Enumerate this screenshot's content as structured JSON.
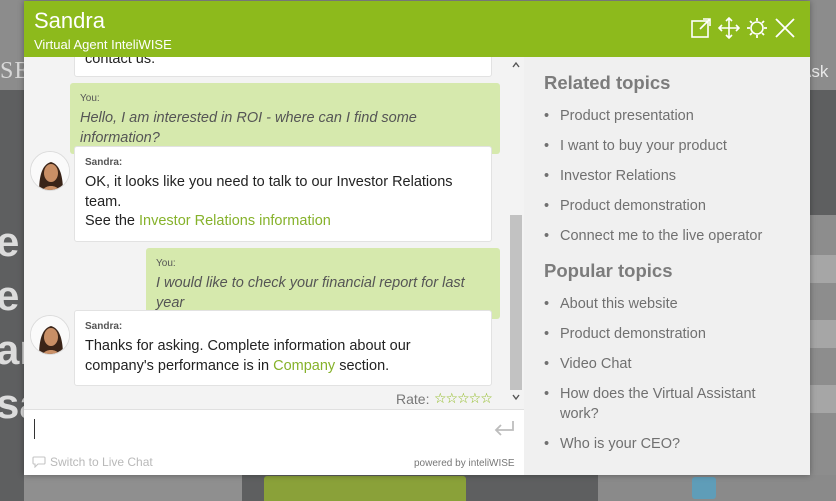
{
  "background": {
    "logo": "SE",
    "ask": "Ask f",
    "hero_lines": [
      "e",
      "e v",
      "an",
      "sa"
    ]
  },
  "header": {
    "agent_name": "Sandra",
    "subtitle": "Virtual Agent InteliWISE",
    "color": "#8dba1c"
  },
  "conversation": {
    "top_cut_text": "contact us.",
    "messages": [
      {
        "sender": "You:",
        "text": "Hello, I am interested in ROI - where can I find some information?"
      },
      {
        "sender": "Sandra:",
        "line1": "OK, it looks like you need to talk to our Investor Relations",
        "line2": "team.",
        "line3_prefix": "See the ",
        "link": "Investor Relations information"
      },
      {
        "sender": "You:",
        "text": "I would like to check your financial report for last year"
      },
      {
        "sender": "Sandra:",
        "line1": "Thanks for asking. Complete information about our",
        "line2_prefix": "company's performance is in ",
        "link": "Company",
        "line2_suffix": " section."
      }
    ],
    "rate_label": "Rate:",
    "rate_stars": "☆☆☆☆☆"
  },
  "input": {
    "placeholder": "",
    "switch_live_chat": "Switch to Live Chat",
    "powered_by": "powered by inteliWISE"
  },
  "topics": {
    "related_title": "Related topics",
    "related": [
      "Product presentation",
      "I want to buy your product",
      "Investor Relations",
      "Product demonstration",
      "Connect me to the live operator"
    ],
    "popular_title": "Popular topics",
    "popular": [
      "About this website",
      "Product demonstration",
      "Video Chat",
      "How does the Virtual Assistant work?",
      "Who is your CEO?"
    ],
    "bullet": "•"
  },
  "icons": {
    "popout": "external-window-icon",
    "move": "move-arrows-icon",
    "settings": "gear-icon",
    "close": "close-icon",
    "enter": "enter-return-icon",
    "chat": "chat-bubble-icon"
  }
}
